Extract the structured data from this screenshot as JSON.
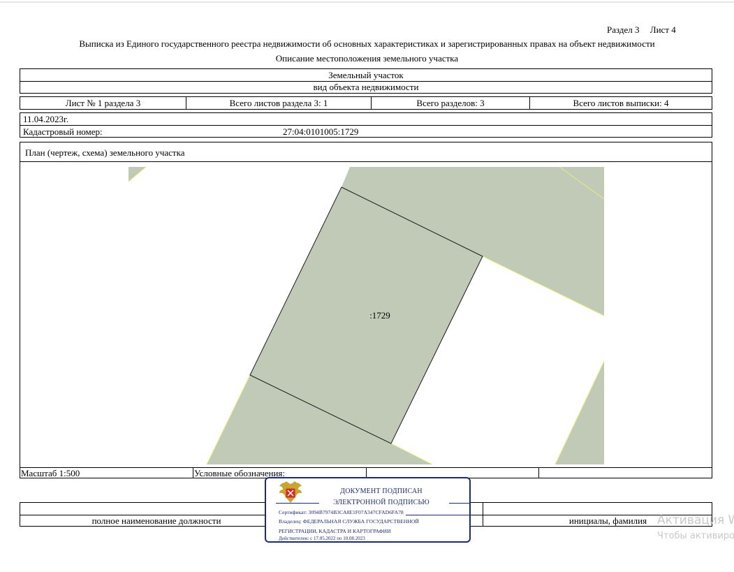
{
  "header": {
    "section_label": "Раздел 3",
    "sheet_label": "Лист 4",
    "title": "Выписка из Единого государственного реестра недвижимости об основных характеристиках и зарегистрированных правах на объект недвижимости",
    "subtitle": "Описание местоположения земельного участка"
  },
  "object": {
    "type": "Земельный участок",
    "type_caption": "вид объекта недвижимости"
  },
  "sheets": {
    "sheet_of_section": "Лист № 1 раздела 3",
    "total_sheets_section": "Всего листов раздела 3: 1",
    "total_sections": "Всего разделов: 3",
    "total_sheets_extract": "Всего листов выписки: 4"
  },
  "info": {
    "date": "11.04.2023г.",
    "cadastral_label": "Кадастровый номер:",
    "cadastral_number": "27:04:0101005:1729"
  },
  "plan": {
    "title": "План (чертеж, схема) земельного участка",
    "parcel_label": ":1729",
    "colors": {
      "parcel_fill": "#c0cab6",
      "boundary_line": "#1a1a1a",
      "neighbor_edge": "#e8ec7c"
    }
  },
  "footer": {
    "scale": "Масштаб 1:500",
    "legend": "Условные обозначения:",
    "position_caption": "полное наименование должности",
    "name_caption": "инициалы, фамилия"
  },
  "stamp": {
    "line1": "ДОКУМЕНТ ПОДПИСАН",
    "line2": "ЭЛЕКТРОННОЙ ПОДПИСЬЮ",
    "certificate": "Сертификат: 3094B7974B3CA8E1F07A347CFAD6FA78",
    "owner_line1": "Владелец: ФЕДЕРАЛЬНАЯ СЛУЖБА ГОСУДАРСТВЕННОЙ",
    "owner_line2": "РЕГИСТРАЦИИ, КАДАСТРА И КАРТОГРАФИИ",
    "valid": "Действителен: с 17.05.2022 по 10.08.2023",
    "color": "#1e2b6b"
  },
  "watermark": {
    "line1": "Активация W",
    "line2": "Чтобы активиро"
  }
}
